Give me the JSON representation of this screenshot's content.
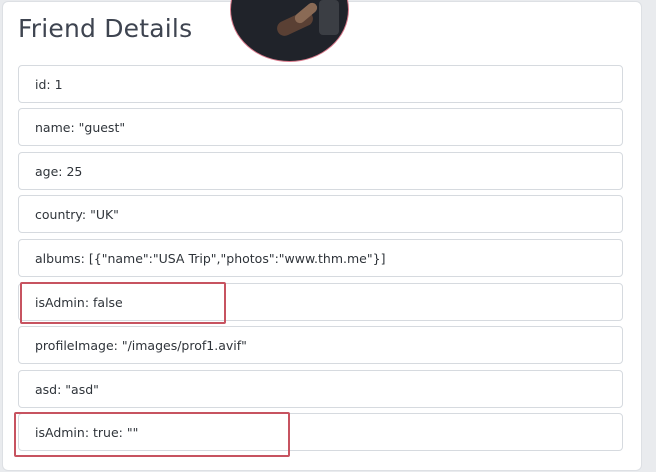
{
  "title": "Friend Details",
  "fields": [
    "id: 1",
    "name: \"guest\"",
    "age: 25",
    "country: \"UK\"",
    "albums: [{\"name\":\"USA Trip\",\"photos\":\"www.thm.me\"}]",
    "isAdmin: false",
    "profileImage: \"/images/prof1.avif\"",
    "asd: \"asd\"",
    "isAdmin: true: \"\""
  ],
  "colors": {
    "highlight": "#c75360",
    "avatar_border": "#d97a8c"
  }
}
